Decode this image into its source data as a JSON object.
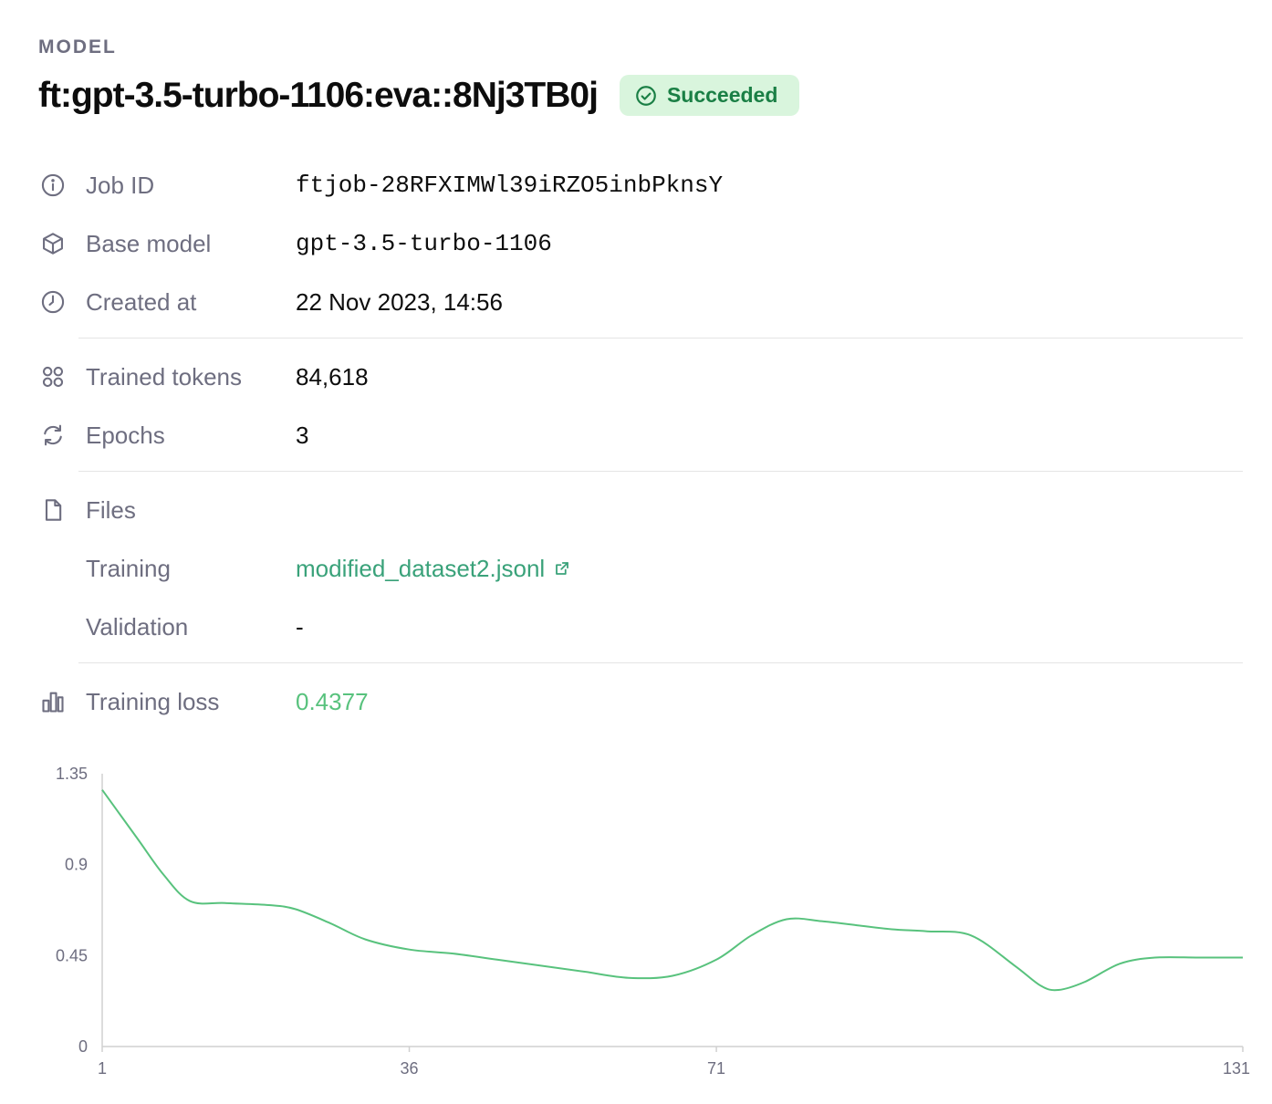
{
  "header": {
    "eyebrow": "MODEL",
    "model_name": "ft:gpt-3.5-turbo-1106:eva::8Nj3TB0j",
    "status": "Succeeded"
  },
  "details": {
    "job_id": {
      "label": "Job ID",
      "value": "ftjob-28RFXIMWl39iRZO5inbPknsY",
      "icon": "info-icon"
    },
    "base_model": {
      "label": "Base model",
      "value": "gpt-3.5-turbo-1106",
      "icon": "cube-icon"
    },
    "created_at": {
      "label": "Created at",
      "value": "22 Nov 2023, 14:56",
      "icon": "clock-icon"
    },
    "trained_tokens": {
      "label": "Trained tokens",
      "value": "84,618",
      "icon": "grid-icon"
    },
    "epochs": {
      "label": "Epochs",
      "value": "3",
      "icon": "refresh-icon"
    },
    "files": {
      "label": "Files",
      "icon": "file-icon",
      "training": {
        "label": "Training",
        "value": "modified_dataset2.jsonl"
      },
      "validation": {
        "label": "Validation",
        "value": "-"
      }
    },
    "training_loss": {
      "label": "Training loss",
      "value": "0.4377",
      "icon": "bar-chart-icon"
    }
  },
  "colors": {
    "accent": "#58c27d",
    "link": "#3aa27a",
    "badge_bg": "#d9f5dd",
    "badge_text": "#1a7f45",
    "muted": "#6e6e80"
  },
  "chart_data": {
    "type": "line",
    "title": "",
    "xlabel": "",
    "ylabel": "",
    "xlim": [
      1,
      131
    ],
    "ylim": [
      0,
      1.35
    ],
    "x_ticks": [
      "1",
      "36",
      "71",
      "131"
    ],
    "y_ticks": [
      "1.35",
      "0.9",
      "0.45",
      "0"
    ],
    "series": [
      {
        "x": [
          1,
          5,
          8,
          11,
          15,
          20,
          23,
          27,
          31,
          36,
          41,
          46,
          51,
          56,
          61,
          66,
          71,
          75,
          79,
          83,
          87,
          91,
          95,
          100,
          105,
          108,
          110,
          113,
          117,
          121,
          126,
          131
        ],
        "y": [
          1.27,
          1.03,
          0.85,
          0.72,
          0.71,
          0.7,
          0.68,
          0.61,
          0.53,
          0.48,
          0.46,
          0.43,
          0.4,
          0.37,
          0.34,
          0.35,
          0.43,
          0.55,
          0.63,
          0.62,
          0.6,
          0.58,
          0.57,
          0.55,
          0.4,
          0.3,
          0.28,
          0.32,
          0.41,
          0.44,
          0.44,
          0.44
        ]
      }
    ]
  }
}
